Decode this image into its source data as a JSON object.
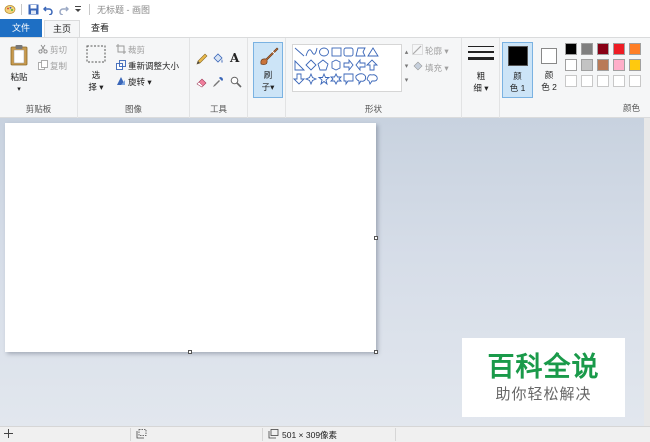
{
  "titlebar": {
    "title": "无标题 - 画图",
    "icons": [
      "paint-app-icon",
      "save-icon",
      "undo-icon",
      "redo-icon",
      "customize-dropdown-icon"
    ]
  },
  "tabs": {
    "file": "文件",
    "home": "主页",
    "view": "查看"
  },
  "ribbon": {
    "clipboard": {
      "paste": "粘贴",
      "cut": "剪切",
      "copy": "复制",
      "label": "剪贴板"
    },
    "image": {
      "select_top": "选",
      "select_bottom": "择",
      "crop": "裁剪",
      "resize": "重新调整大小",
      "rotate": "旋转",
      "label": "图像"
    },
    "tools": {
      "label": "工具"
    },
    "brushes": {
      "top": "刷",
      "bottom": "子"
    },
    "shapes": {
      "outline": "轮廓",
      "fill": "填充",
      "label": "形状"
    },
    "size": {
      "top": "粗",
      "bottom": "细"
    },
    "color1": {
      "top": "颜",
      "bottom": "色 1",
      "value": "#000000"
    },
    "color2": {
      "top": "颜",
      "bottom": "色 2",
      "value": "#ffffff"
    },
    "colors": {
      "label": "颜色",
      "row1": [
        "#000000",
        "#7f7f7f",
        "#880015",
        "#ed1c24",
        "#ff7f27"
      ],
      "row2": [
        "#ffffff",
        "#c3c3c3",
        "#b97a57",
        "#ffaec9",
        "#ffc90e"
      ]
    }
  },
  "statusbar": {
    "image_size": "501 × 309像素"
  },
  "watermark": {
    "title": "百科全说",
    "subtitle": "助你轻松解决"
  }
}
